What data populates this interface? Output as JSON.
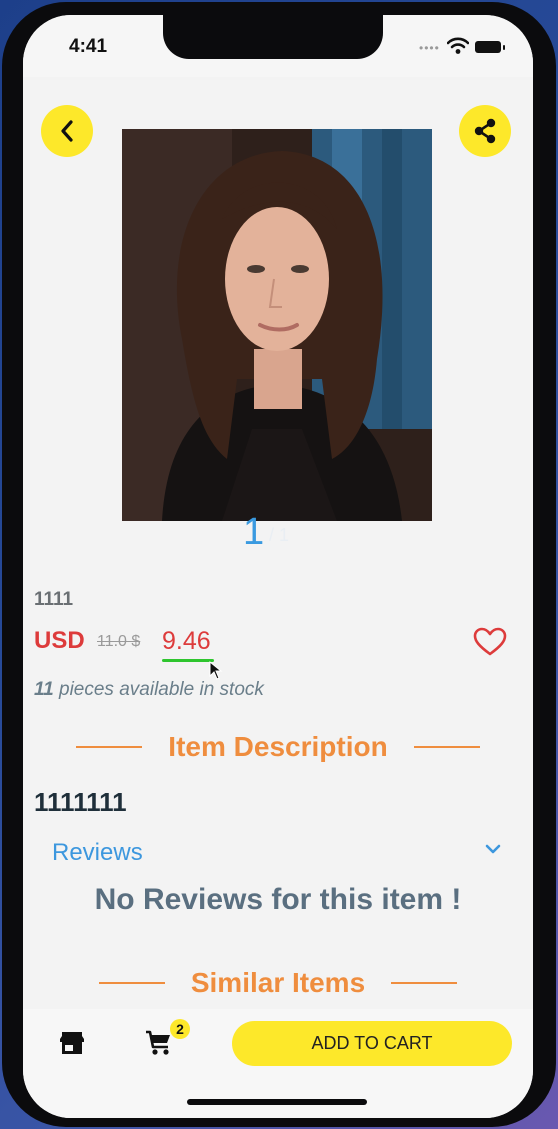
{
  "status_bar": {
    "time": "4:41",
    "signal_icon": "cellular-dots-icon",
    "wifi_icon": "wifi-icon",
    "battery_icon": "battery-icon"
  },
  "header": {
    "back_icon": "chevron-left-icon",
    "share_icon": "share-icon"
  },
  "product": {
    "image_subject": "portrait-photo",
    "pager_current": "1",
    "pager_total": "/ 1",
    "name": "1111",
    "currency": "USD",
    "old_price": "11.0 $",
    "price": "9.46",
    "stock_count": "11",
    "stock_text": " pieces available in stock",
    "favorite_icon": "heart-outline-icon"
  },
  "description_section": {
    "title": "Item Description",
    "text": "1111111"
  },
  "reviews": {
    "label": "Reviews",
    "toggle_icon": "chevron-down-icon",
    "empty_message": "No Reviews for this item !"
  },
  "similar_section": {
    "title": "Similar Items"
  },
  "bottom_bar": {
    "store_icon": "store-icon",
    "cart_icon": "cart-icon",
    "cart_count": "2",
    "add_to_cart_label": "ADD TO CART"
  },
  "colors": {
    "accent_yellow": "#fde82a",
    "price_red": "#dd3b3b",
    "section_orange": "#ef8d3e",
    "link_blue": "#3c97de"
  }
}
